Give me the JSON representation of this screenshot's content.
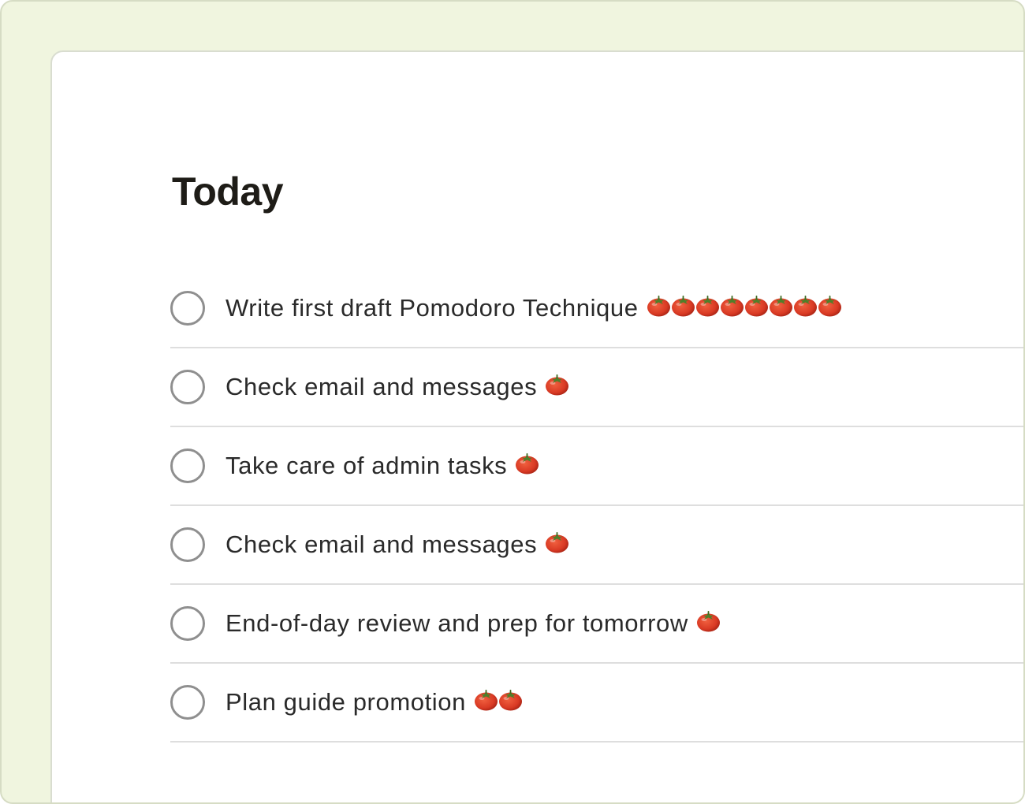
{
  "page": {
    "title": "Today"
  },
  "colors": {
    "outer_background": "#f0f5df",
    "card_background": "#ffffff",
    "tomato": "#d93a24",
    "checkbox_border": "#8f8f8f"
  },
  "tasks": [
    {
      "label": "Write first draft Pomodoro Technique",
      "pomodoros": 8,
      "completed": false
    },
    {
      "label": "Check email and messages",
      "pomodoros": 1,
      "completed": false
    },
    {
      "label": "Take care of admin tasks",
      "pomodoros": 1,
      "completed": false
    },
    {
      "label": "Check email and messages",
      "pomodoros": 1,
      "completed": false
    },
    {
      "label": "End-of-day review and prep for tomorrow",
      "pomodoros": 1,
      "completed": false
    },
    {
      "label": "Plan guide promotion",
      "pomodoros": 2,
      "completed": false
    }
  ],
  "icons": {
    "checkbox": "circle-checkbox-icon",
    "pomodoro": "tomato-icon"
  }
}
